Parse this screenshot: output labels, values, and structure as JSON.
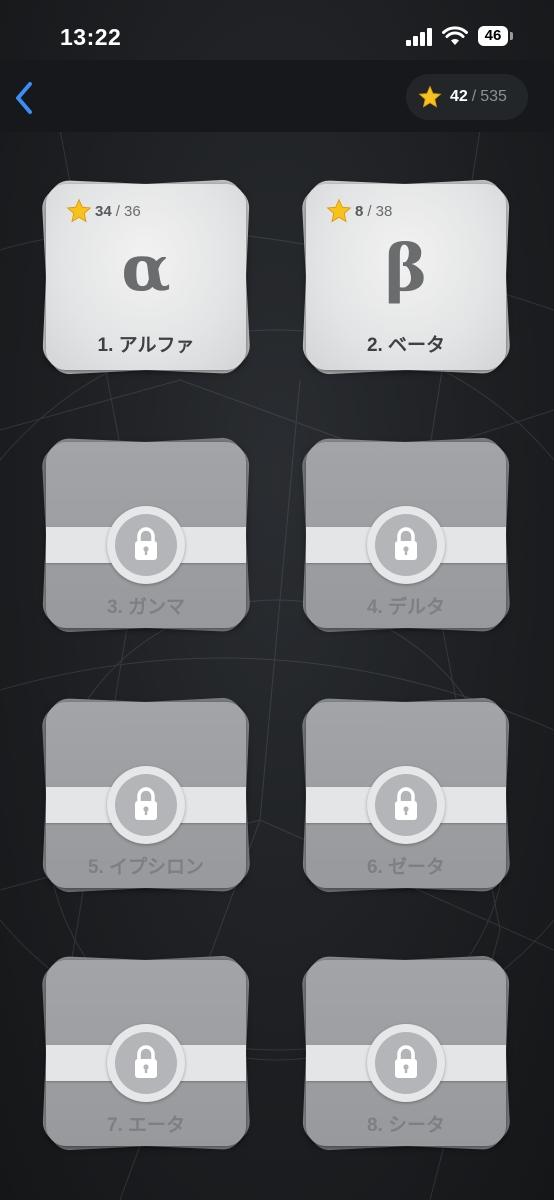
{
  "status_bar": {
    "time": "13:22",
    "battery": "46"
  },
  "header": {
    "stars_earned": "42",
    "separator": "/",
    "stars_total": "535"
  },
  "levels": [
    {
      "title": "1. アルファ",
      "symbol": "α",
      "stars_earned": "34",
      "stars_total": "/ 36",
      "locked": false
    },
    {
      "title": "2. ベータ",
      "symbol": "β",
      "stars_earned": "8",
      "stars_total": "/ 38",
      "locked": false
    },
    {
      "title": "3. ガンマ",
      "locked": true
    },
    {
      "title": "4. デルタ",
      "locked": true
    },
    {
      "title": "5. イプシロン",
      "locked": true
    },
    {
      "title": "6. ゼータ",
      "locked": true
    },
    {
      "title": "7. エータ",
      "locked": true
    },
    {
      "title": "8. シータ",
      "locked": true
    }
  ],
  "colors": {
    "star": "#f7c21b",
    "back_accent": "#3a8ef5",
    "background": "#1c1e21"
  },
  "icons": {
    "back": "chevron-left-icon",
    "star": "star-icon",
    "lock": "lock-icon"
  }
}
